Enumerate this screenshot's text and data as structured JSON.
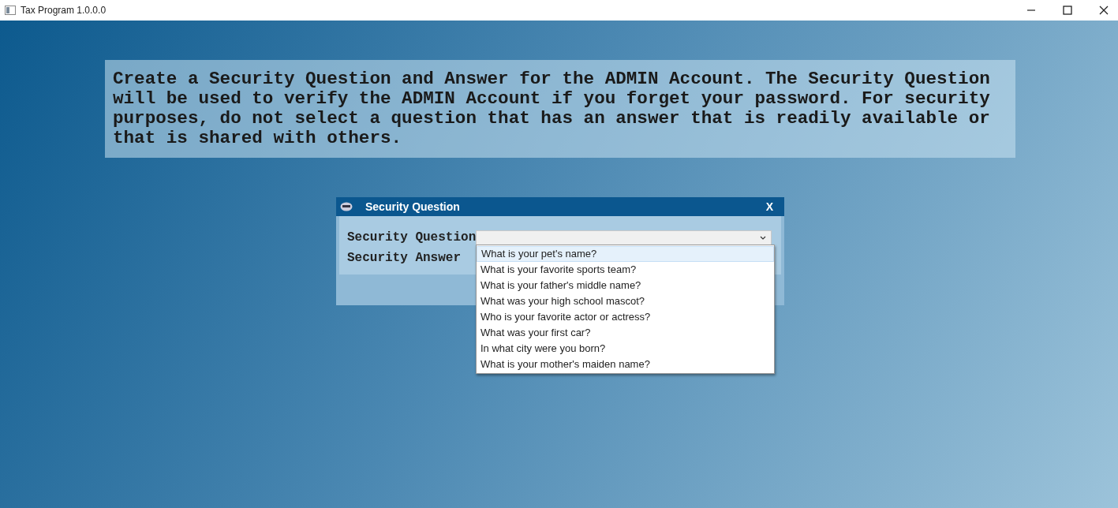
{
  "window": {
    "title": "Tax Program 1.0.0.0"
  },
  "notice": "Create a Security Question and Answer for the ADMIN Account. The Security Question will be used to verify the ADMIN Account if you forget your password. For security purposes, do not select a question that has an answer that is readily available or that is shared with others.",
  "dialog": {
    "title": "Security Question",
    "close": "X",
    "labels": [
      "Security Question",
      "Security Answer"
    ],
    "question_options": [
      {
        "label": "What is your pet's name?",
        "selected": true
      },
      {
        "label": "What is your favorite sports team?",
        "selected": false
      },
      {
        "label": "What is your father's middle name?",
        "selected": false
      },
      {
        "label": "What was your high school mascot?",
        "selected": false
      },
      {
        "label": "Who is your favorite actor or actress?",
        "selected": false
      },
      {
        "label": "What was your first car?",
        "selected": false
      },
      {
        "label": "In what city were you born?",
        "selected": false
      },
      {
        "label": "What is your mother's maiden name?",
        "selected": false
      }
    ]
  }
}
